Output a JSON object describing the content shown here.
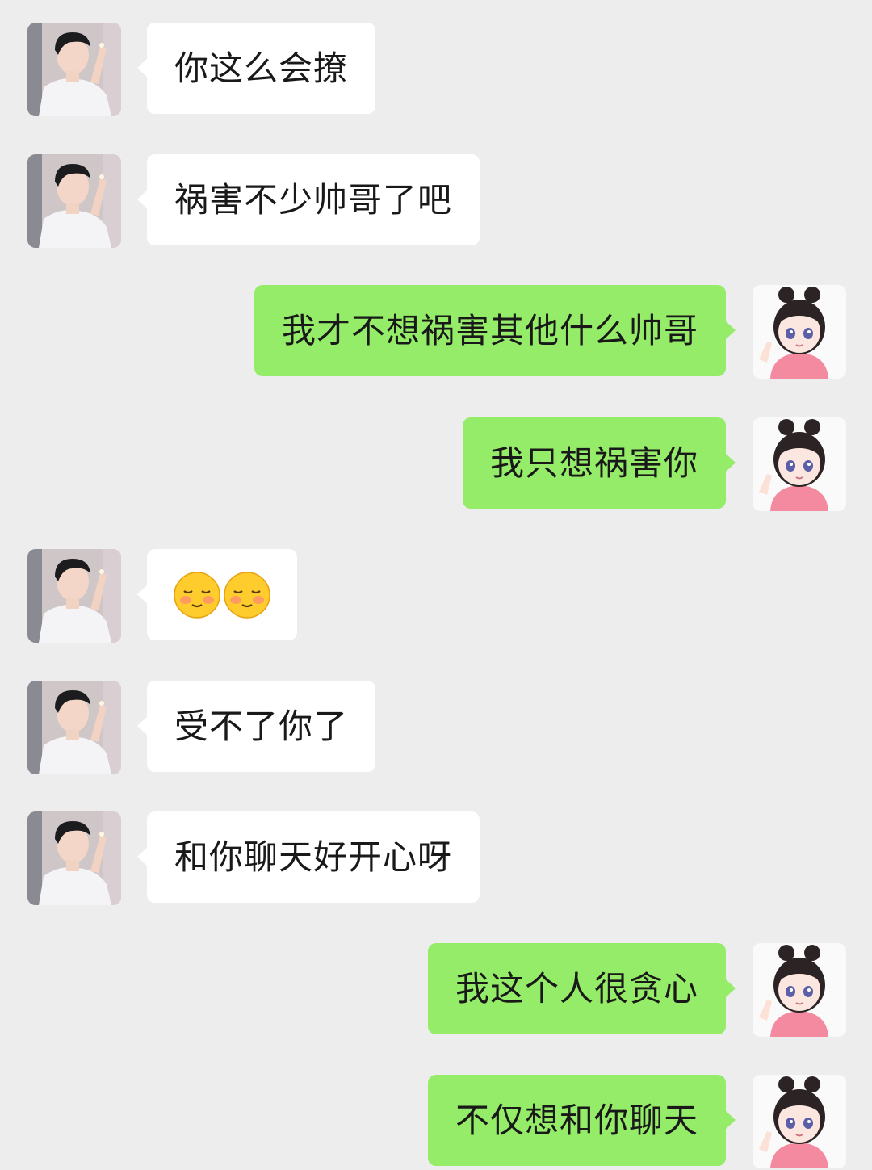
{
  "chat": {
    "messages": [
      {
        "sender": "other",
        "text": "你这么会撩"
      },
      {
        "sender": "other",
        "text": "祸害不少帅哥了吧"
      },
      {
        "sender": "me",
        "text": "我才不想祸害其他什么帅哥"
      },
      {
        "sender": "me",
        "text": "我只想祸害你"
      },
      {
        "sender": "other",
        "emoji": [
          "shy-smile-emoji",
          "shy-smile-emoji"
        ]
      },
      {
        "sender": "other",
        "text": "受不了你了"
      },
      {
        "sender": "other",
        "text": "和你聊天好开心呀"
      },
      {
        "sender": "me",
        "text": "我这个人很贪心"
      },
      {
        "sender": "me",
        "text": "不仅想和你聊天"
      }
    ]
  },
  "colors": {
    "background": "#ededed",
    "incoming_bubble": "#ffffff",
    "outgoing_bubble": "#95ec69",
    "text": "#191919"
  }
}
